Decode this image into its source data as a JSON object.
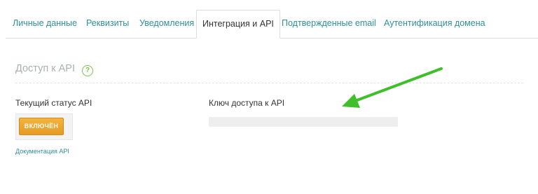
{
  "tabs": [
    {
      "label": "Личные данные",
      "active": false
    },
    {
      "label": "Реквизиты",
      "active": false
    },
    {
      "label": "Уведомления",
      "active": false
    },
    {
      "label": "Интеграция и API",
      "active": true
    },
    {
      "label": "Подтвержденные email",
      "active": false
    },
    {
      "label": "Аутентификация домена",
      "active": false
    }
  ],
  "section": {
    "title": "Доступ к API",
    "help_icon": "?"
  },
  "status": {
    "label": "Текущий статус API",
    "button_label": "ВКЛЮЧЁН",
    "doc_link": "Документация API"
  },
  "api_key": {
    "label": "Ключ доступа к API",
    "value": ""
  },
  "colors": {
    "accent": "#2f8f95",
    "status_button": "#eea52e",
    "arrow": "#3fbf2a",
    "help_icon": "#79c24c"
  },
  "icons": {
    "help": "question-circle-icon",
    "annotation": "green-arrow-icon"
  }
}
